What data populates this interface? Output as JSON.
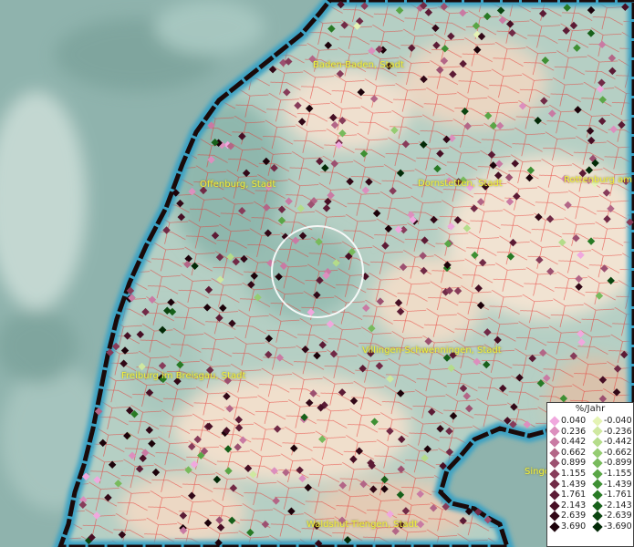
{
  "places": [
    {
      "key": "baden_baden",
      "label": "Baden-Baden, Stadt"
    },
    {
      "key": "offenburg",
      "label": "Offenburg, Stadt"
    },
    {
      "key": "dornstetten",
      "label": "Dornstetten, Stadt"
    },
    {
      "key": "rottenburg",
      "label": "Rottenburg am N"
    },
    {
      "key": "villingen",
      "label": "Villingen-Schwenningen, Stadt"
    },
    {
      "key": "freiburg",
      "label": "Freiburg im Breisgau, Stadt"
    },
    {
      "key": "waldshut",
      "label": "Waldshut-Tiengen, Stadt"
    },
    {
      "key": "singen",
      "label": "Singe"
    }
  ],
  "legend": {
    "title": "%/Jahr",
    "rows": [
      {
        "pos": "0.040",
        "neg": "-0.040",
        "pos_color": "#f0a8de",
        "neg_color": "#e4f3b4"
      },
      {
        "pos": "0.236",
        "neg": "-0.236",
        "pos_color": "#dc8fbe",
        "neg_color": "#cfe8a0"
      },
      {
        "pos": "0.442",
        "neg": "-0.442",
        "pos_color": "#c97aa3",
        "neg_color": "#b4dc8a"
      },
      {
        "pos": "0.662",
        "neg": "-0.662",
        "pos_color": "#b36687",
        "neg_color": "#95cc72"
      },
      {
        "pos": "0.899",
        "neg": "-0.899",
        "pos_color": "#9c5070",
        "neg_color": "#78ba5c"
      },
      {
        "pos": "1.155",
        "neg": "-1.155",
        "pos_color": "#873c5a",
        "neg_color": "#5aa646"
      },
      {
        "pos": "1.439",
        "neg": "-1.439",
        "pos_color": "#712a46",
        "neg_color": "#3f9034"
      },
      {
        "pos": "1.761",
        "neg": "-1.761",
        "pos_color": "#5c1b35",
        "neg_color": "#287a25"
      },
      {
        "pos": "2.143",
        "neg": "-2.143",
        "pos_color": "#470f25",
        "neg_color": "#17601a"
      },
      {
        "pos": "2.639",
        "neg": "-2.639",
        "pos_color": "#320817",
        "neg_color": "#0b4510"
      },
      {
        "pos": "3.690",
        "neg": "-3.690",
        "pos_color": "#1c020a",
        "neg_color": "#032a07"
      }
    ]
  },
  "colors": {
    "background": "#8fb3ad",
    "terrain": "#e6d3bf",
    "border_outline": "#1a0a0a",
    "border_glow": "#3aa2c4",
    "municipal_lines": "#e8332f",
    "label_text": "#f2ef3a",
    "ring": "#ffffff"
  }
}
